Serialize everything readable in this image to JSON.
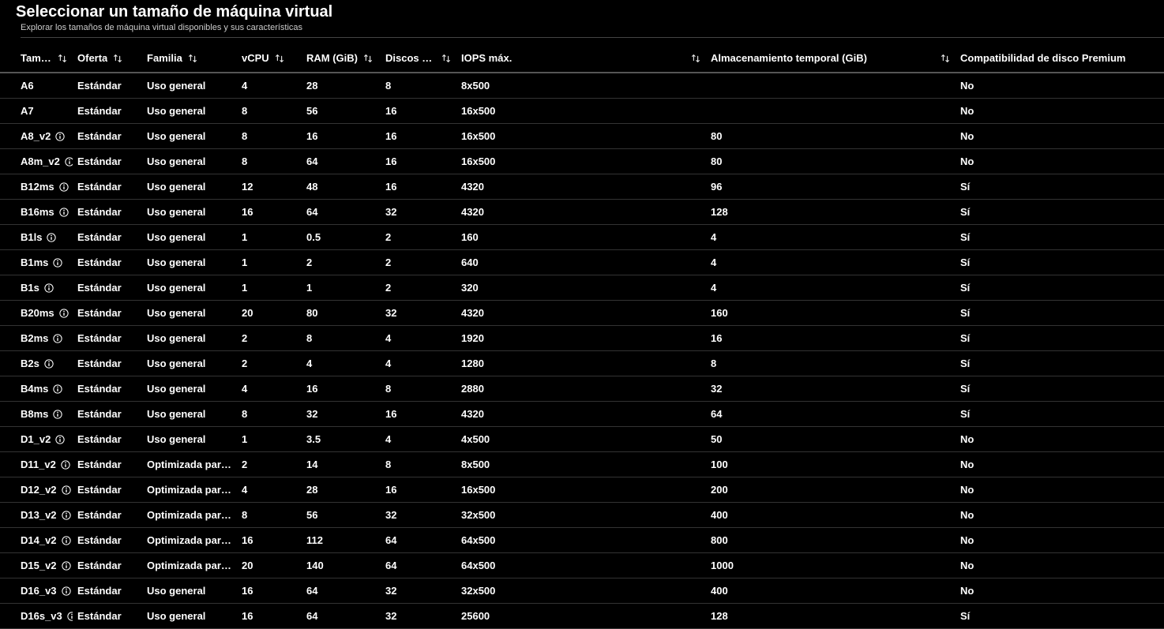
{
  "header": {
    "title": "Seleccionar un tamaño de máquina virtual",
    "subtitle": "Explorar los tamaños de máquina virtual disponibles y sus características"
  },
  "columns": {
    "size": "Tamaño …",
    "offer": "Oferta",
    "family": "Familia",
    "vcpu": "vCPU",
    "ram": "RAM (GiB)",
    "disks": "Discos de …",
    "iops": "IOPS máx.",
    "temp": "Almacenamiento temporal (GiB)",
    "premium": "Compatibilidad de disco Premium"
  },
  "rows": [
    {
      "size": "A6",
      "info": false,
      "offer": "Estándar",
      "family": "Uso general",
      "vcpu": "4",
      "ram": "28",
      "disks": "8",
      "iops": "8x500",
      "temp": "",
      "premium": "No"
    },
    {
      "size": "A7",
      "info": false,
      "offer": "Estándar",
      "family": "Uso general",
      "vcpu": "8",
      "ram": "56",
      "disks": "16",
      "iops": "16x500",
      "temp": "",
      "premium": "No"
    },
    {
      "size": "A8_v2",
      "info": true,
      "offer": "Estándar",
      "family": "Uso general",
      "vcpu": "8",
      "ram": "16",
      "disks": "16",
      "iops": "16x500",
      "temp": "80",
      "premium": "No"
    },
    {
      "size": "A8m_v2",
      "info": true,
      "offer": "Estándar",
      "family": "Uso general",
      "vcpu": "8",
      "ram": "64",
      "disks": "16",
      "iops": "16x500",
      "temp": "80",
      "premium": "No"
    },
    {
      "size": "B12ms",
      "info": true,
      "offer": "Estándar",
      "family": "Uso general",
      "vcpu": "12",
      "ram": "48",
      "disks": "16",
      "iops": "4320",
      "temp": "96",
      "premium": "Sí"
    },
    {
      "size": "B16ms",
      "info": true,
      "offer": "Estándar",
      "family": "Uso general",
      "vcpu": "16",
      "ram": "64",
      "disks": "32",
      "iops": "4320",
      "temp": "128",
      "premium": "Sí"
    },
    {
      "size": "B1ls",
      "info": true,
      "offer": "Estándar",
      "family": "Uso general",
      "vcpu": "1",
      "ram": "0.5",
      "disks": "2",
      "iops": "160",
      "temp": "4",
      "premium": "Sí"
    },
    {
      "size": "B1ms",
      "info": true,
      "offer": "Estándar",
      "family": "Uso general",
      "vcpu": "1",
      "ram": "2",
      "disks": "2",
      "iops": "640",
      "temp": "4",
      "premium": "Sí"
    },
    {
      "size": "B1s",
      "info": true,
      "offer": "Estándar",
      "family": "Uso general",
      "vcpu": "1",
      "ram": "1",
      "disks": "2",
      "iops": "320",
      "temp": "4",
      "premium": "Sí"
    },
    {
      "size": "B20ms",
      "info": true,
      "offer": "Estándar",
      "family": "Uso general",
      "vcpu": "20",
      "ram": "80",
      "disks": "32",
      "iops": "4320",
      "temp": "160",
      "premium": "Sí"
    },
    {
      "size": "B2ms",
      "info": true,
      "offer": "Estándar",
      "family": "Uso general",
      "vcpu": "2",
      "ram": "8",
      "disks": "4",
      "iops": "1920",
      "temp": "16",
      "premium": "Sí"
    },
    {
      "size": "B2s",
      "info": true,
      "offer": "Estándar",
      "family": "Uso general",
      "vcpu": "2",
      "ram": "4",
      "disks": "4",
      "iops": "1280",
      "temp": "8",
      "premium": "Sí"
    },
    {
      "size": "B4ms",
      "info": true,
      "offer": "Estándar",
      "family": "Uso general",
      "vcpu": "4",
      "ram": "16",
      "disks": "8",
      "iops": "2880",
      "temp": "32",
      "premium": "Sí"
    },
    {
      "size": "B8ms",
      "info": true,
      "offer": "Estándar",
      "family": "Uso general",
      "vcpu": "8",
      "ram": "32",
      "disks": "16",
      "iops": "4320",
      "temp": "64",
      "premium": "Sí"
    },
    {
      "size": "D1_v2",
      "info": true,
      "offer": "Estándar",
      "family": "Uso general",
      "vcpu": "1",
      "ram": "3.5",
      "disks": "4",
      "iops": "4x500",
      "temp": "50",
      "premium": "No"
    },
    {
      "size": "D11_v2",
      "info": true,
      "offer": "Estándar",
      "family": "Optimizada para …",
      "vcpu": "2",
      "ram": "14",
      "disks": "8",
      "iops": "8x500",
      "temp": "100",
      "premium": "No"
    },
    {
      "size": "D12_v2",
      "info": true,
      "offer": "Estándar",
      "family": "Optimizada para …",
      "vcpu": "4",
      "ram": "28",
      "disks": "16",
      "iops": "16x500",
      "temp": "200",
      "premium": "No"
    },
    {
      "size": "D13_v2",
      "info": true,
      "offer": "Estándar",
      "family": "Optimizada para …",
      "vcpu": "8",
      "ram": "56",
      "disks": "32",
      "iops": "32x500",
      "temp": "400",
      "premium": "No"
    },
    {
      "size": "D14_v2",
      "info": true,
      "offer": "Estándar",
      "family": "Optimizada para …",
      "vcpu": "16",
      "ram": "112",
      "disks": "64",
      "iops": "64x500",
      "temp": "800",
      "premium": "No"
    },
    {
      "size": "D15_v2",
      "info": true,
      "offer": "Estándar",
      "family": "Optimizada para …",
      "vcpu": "20",
      "ram": "140",
      "disks": "64",
      "iops": "64x500",
      "temp": "1000",
      "premium": "No"
    },
    {
      "size": "D16_v3",
      "info": true,
      "offer": "Estándar",
      "family": "Uso general",
      "vcpu": "16",
      "ram": "64",
      "disks": "32",
      "iops": "32x500",
      "temp": "400",
      "premium": "No"
    },
    {
      "size": "D16s_v3",
      "info": true,
      "offer": "Estándar",
      "family": "Uso general",
      "vcpu": "16",
      "ram": "64",
      "disks": "32",
      "iops": "25600",
      "temp": "128",
      "premium": "Sí"
    }
  ]
}
